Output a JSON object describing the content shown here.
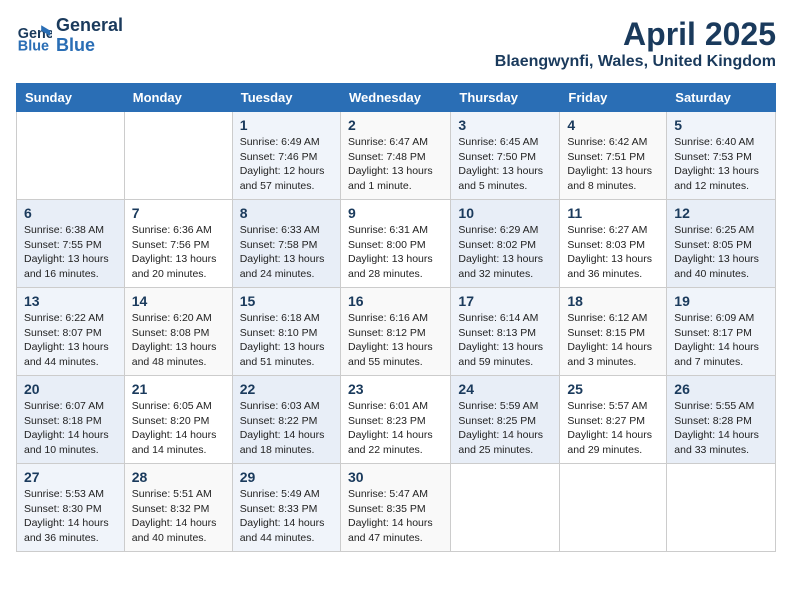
{
  "header": {
    "logo_line1": "General",
    "logo_line2": "Blue",
    "month_year": "April 2025",
    "location": "Blaengwynfi, Wales, United Kingdom"
  },
  "weekdays": [
    "Sunday",
    "Monday",
    "Tuesday",
    "Wednesday",
    "Thursday",
    "Friday",
    "Saturday"
  ],
  "weeks": [
    [
      {
        "day": "",
        "info": ""
      },
      {
        "day": "",
        "info": ""
      },
      {
        "day": "1",
        "info": "Sunrise: 6:49 AM\nSunset: 7:46 PM\nDaylight: 12 hours\nand 57 minutes."
      },
      {
        "day": "2",
        "info": "Sunrise: 6:47 AM\nSunset: 7:48 PM\nDaylight: 13 hours\nand 1 minute."
      },
      {
        "day": "3",
        "info": "Sunrise: 6:45 AM\nSunset: 7:50 PM\nDaylight: 13 hours\nand 5 minutes."
      },
      {
        "day": "4",
        "info": "Sunrise: 6:42 AM\nSunset: 7:51 PM\nDaylight: 13 hours\nand 8 minutes."
      },
      {
        "day": "5",
        "info": "Sunrise: 6:40 AM\nSunset: 7:53 PM\nDaylight: 13 hours\nand 12 minutes."
      }
    ],
    [
      {
        "day": "6",
        "info": "Sunrise: 6:38 AM\nSunset: 7:55 PM\nDaylight: 13 hours\nand 16 minutes."
      },
      {
        "day": "7",
        "info": "Sunrise: 6:36 AM\nSunset: 7:56 PM\nDaylight: 13 hours\nand 20 minutes."
      },
      {
        "day": "8",
        "info": "Sunrise: 6:33 AM\nSunset: 7:58 PM\nDaylight: 13 hours\nand 24 minutes."
      },
      {
        "day": "9",
        "info": "Sunrise: 6:31 AM\nSunset: 8:00 PM\nDaylight: 13 hours\nand 28 minutes."
      },
      {
        "day": "10",
        "info": "Sunrise: 6:29 AM\nSunset: 8:02 PM\nDaylight: 13 hours\nand 32 minutes."
      },
      {
        "day": "11",
        "info": "Sunrise: 6:27 AM\nSunset: 8:03 PM\nDaylight: 13 hours\nand 36 minutes."
      },
      {
        "day": "12",
        "info": "Sunrise: 6:25 AM\nSunset: 8:05 PM\nDaylight: 13 hours\nand 40 minutes."
      }
    ],
    [
      {
        "day": "13",
        "info": "Sunrise: 6:22 AM\nSunset: 8:07 PM\nDaylight: 13 hours\nand 44 minutes."
      },
      {
        "day": "14",
        "info": "Sunrise: 6:20 AM\nSunset: 8:08 PM\nDaylight: 13 hours\nand 48 minutes."
      },
      {
        "day": "15",
        "info": "Sunrise: 6:18 AM\nSunset: 8:10 PM\nDaylight: 13 hours\nand 51 minutes."
      },
      {
        "day": "16",
        "info": "Sunrise: 6:16 AM\nSunset: 8:12 PM\nDaylight: 13 hours\nand 55 minutes."
      },
      {
        "day": "17",
        "info": "Sunrise: 6:14 AM\nSunset: 8:13 PM\nDaylight: 13 hours\nand 59 minutes."
      },
      {
        "day": "18",
        "info": "Sunrise: 6:12 AM\nSunset: 8:15 PM\nDaylight: 14 hours\nand 3 minutes."
      },
      {
        "day": "19",
        "info": "Sunrise: 6:09 AM\nSunset: 8:17 PM\nDaylight: 14 hours\nand 7 minutes."
      }
    ],
    [
      {
        "day": "20",
        "info": "Sunrise: 6:07 AM\nSunset: 8:18 PM\nDaylight: 14 hours\nand 10 minutes."
      },
      {
        "day": "21",
        "info": "Sunrise: 6:05 AM\nSunset: 8:20 PM\nDaylight: 14 hours\nand 14 minutes."
      },
      {
        "day": "22",
        "info": "Sunrise: 6:03 AM\nSunset: 8:22 PM\nDaylight: 14 hours\nand 18 minutes."
      },
      {
        "day": "23",
        "info": "Sunrise: 6:01 AM\nSunset: 8:23 PM\nDaylight: 14 hours\nand 22 minutes."
      },
      {
        "day": "24",
        "info": "Sunrise: 5:59 AM\nSunset: 8:25 PM\nDaylight: 14 hours\nand 25 minutes."
      },
      {
        "day": "25",
        "info": "Sunrise: 5:57 AM\nSunset: 8:27 PM\nDaylight: 14 hours\nand 29 minutes."
      },
      {
        "day": "26",
        "info": "Sunrise: 5:55 AM\nSunset: 8:28 PM\nDaylight: 14 hours\nand 33 minutes."
      }
    ],
    [
      {
        "day": "27",
        "info": "Sunrise: 5:53 AM\nSunset: 8:30 PM\nDaylight: 14 hours\nand 36 minutes."
      },
      {
        "day": "28",
        "info": "Sunrise: 5:51 AM\nSunset: 8:32 PM\nDaylight: 14 hours\nand 40 minutes."
      },
      {
        "day": "29",
        "info": "Sunrise: 5:49 AM\nSunset: 8:33 PM\nDaylight: 14 hours\nand 44 minutes."
      },
      {
        "day": "30",
        "info": "Sunrise: 5:47 AM\nSunset: 8:35 PM\nDaylight: 14 hours\nand 47 minutes."
      },
      {
        "day": "",
        "info": ""
      },
      {
        "day": "",
        "info": ""
      },
      {
        "day": "",
        "info": ""
      }
    ]
  ]
}
